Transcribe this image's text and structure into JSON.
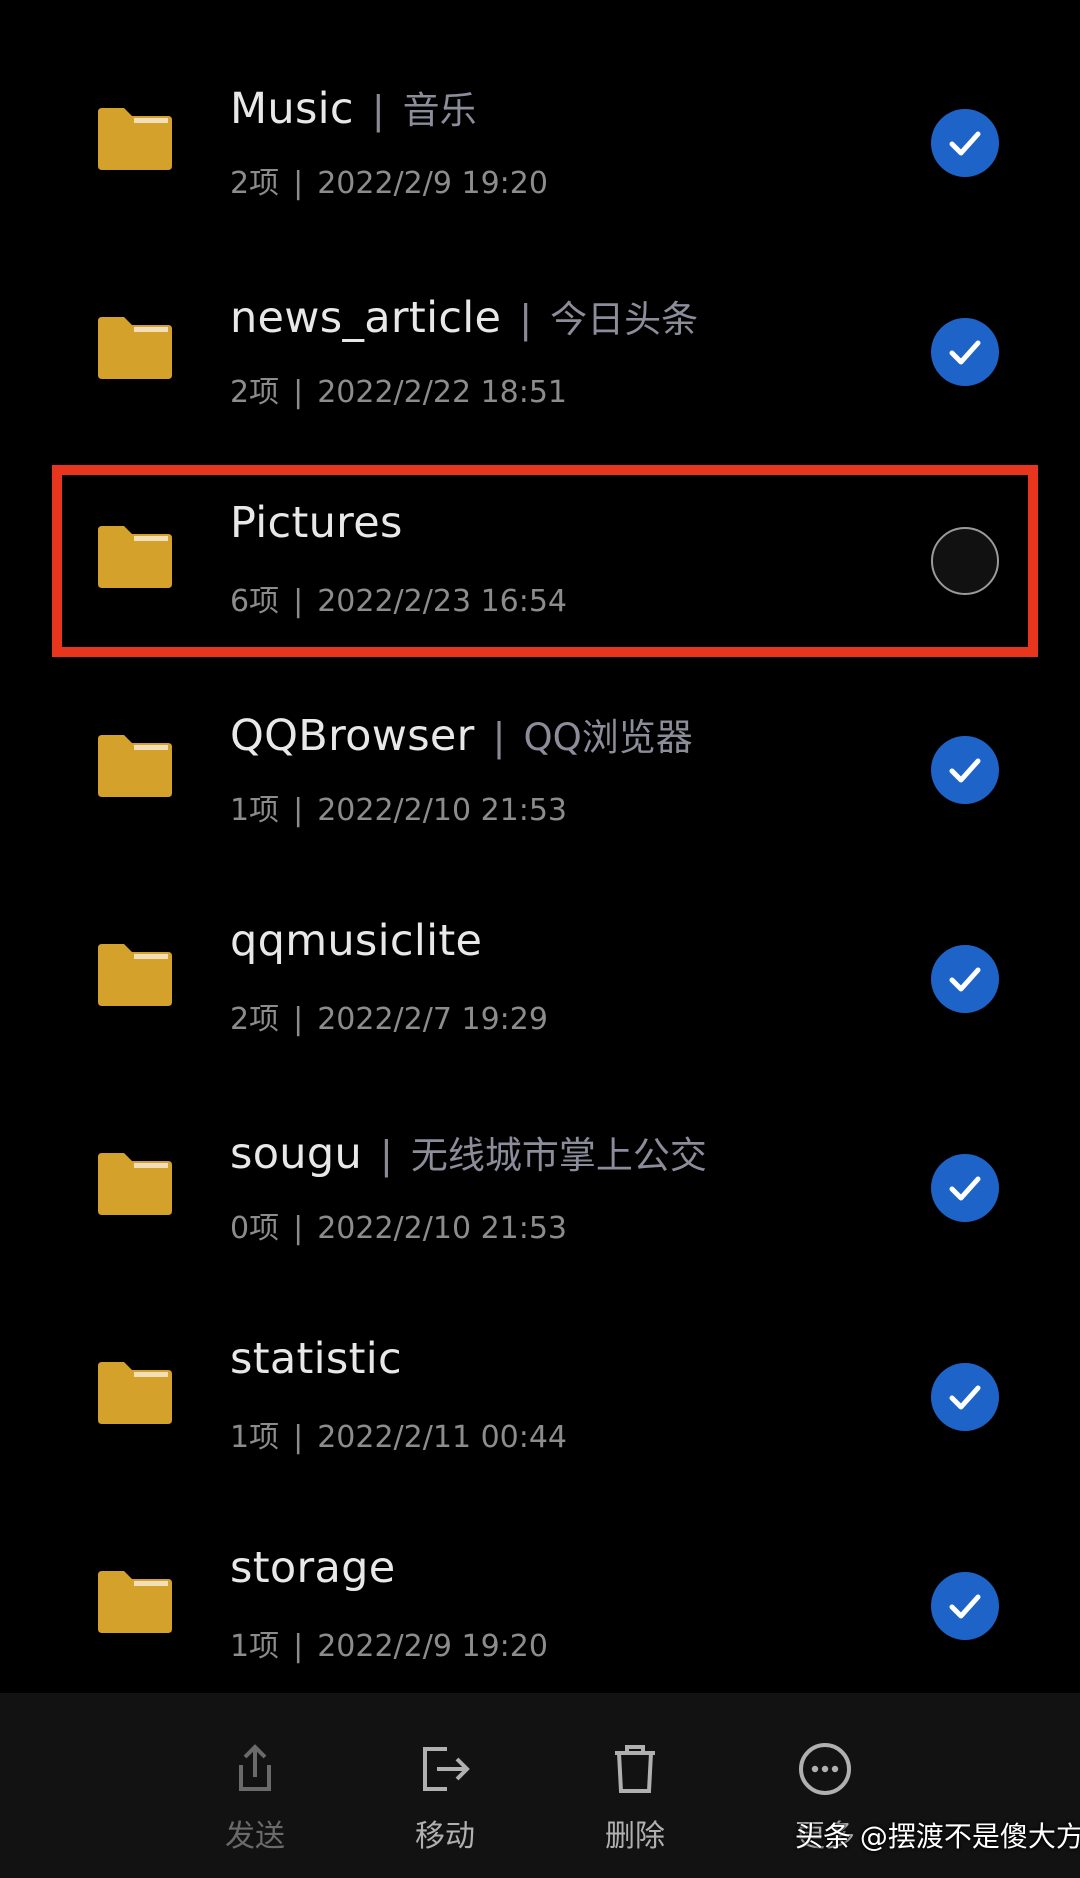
{
  "files": [
    {
      "name": "Music",
      "alias": "音乐",
      "count": "2项",
      "date": "2022/2/9 19:20",
      "selected": true
    },
    {
      "name": "news_article",
      "alias": "今日头条",
      "count": "2项",
      "date": "2022/2/22 18:51",
      "selected": true
    },
    {
      "name": "Pictures",
      "alias": "",
      "count": "6项",
      "date": "2022/2/23 16:54",
      "selected": false
    },
    {
      "name": "QQBrowser",
      "alias": "QQ浏览器",
      "count": "1项",
      "date": "2022/2/10 21:53",
      "selected": true
    },
    {
      "name": "qqmusiclite",
      "alias": "",
      "count": "2项",
      "date": "2022/2/7 19:29",
      "selected": true
    },
    {
      "name": "sougu",
      "alias": "无线城市掌上公交",
      "count": "0项",
      "date": "2022/2/10 21:53",
      "selected": true
    },
    {
      "name": "statistic",
      "alias": "",
      "count": "1项",
      "date": "2022/2/11 00:44",
      "selected": true
    },
    {
      "name": "storage",
      "alias": "",
      "count": "1项",
      "date": "2022/2/9 19:20",
      "selected": true
    }
  ],
  "separator": "|",
  "toolbar": {
    "send_label": "发送",
    "move_label": "移动",
    "delete_label": "删除",
    "more_label": "更多"
  },
  "watermark": "头条 @摆渡不是傻大方",
  "colors": {
    "background": "#000000",
    "folder": "#d4a12b",
    "check_selected": "#1e64c8",
    "highlight_border": "#e8351e"
  },
  "icons": {
    "folder": "folder-icon",
    "check": "checkmark-icon",
    "send": "share-upload-icon",
    "move": "move-out-icon",
    "delete": "trash-icon",
    "more": "more-dots-icon"
  }
}
